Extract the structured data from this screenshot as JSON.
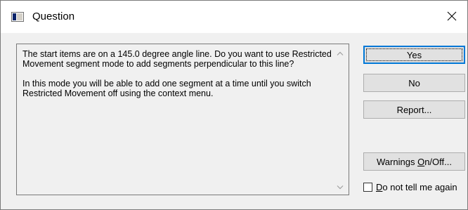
{
  "window": {
    "title": "Question",
    "close_glyph": "×",
    "icon": "window-app-icon"
  },
  "message": {
    "paragraph1": "The start items are on a 145.0 degree angle line. Do you want to use Restricted Movement segment mode to add segments perpendicular to this line?",
    "paragraph2": "In this mode you will be able to add one segment at a time until you switch Restricted Movement off using the context menu."
  },
  "buttons": {
    "yes": "Yes",
    "no": "No",
    "report": "Report...",
    "warnings_before": "Warnings ",
    "warnings_mnemonic": "O",
    "warnings_after": "n/Off..."
  },
  "checkbox": {
    "label_mnemonic": "D",
    "label_rest": "o not tell me again",
    "checked": false
  },
  "colors": {
    "dialog_bg": "#f0f0f0",
    "button_bg": "#e1e1e1",
    "button_border": "#adadad",
    "default_button_accent": "#0078d7"
  }
}
